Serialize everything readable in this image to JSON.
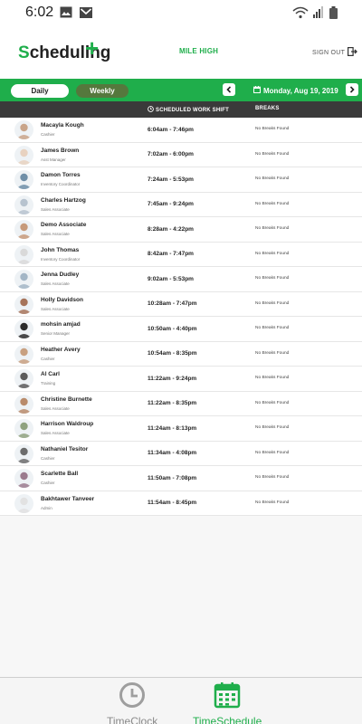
{
  "status_bar": {
    "time": "6:02"
  },
  "header": {
    "logo_letter": "S",
    "logo_rest": "cheduling",
    "location": "MILE HIGH",
    "sign_out": "SIGN OUT"
  },
  "toolbar": {
    "tab_daily": "Daily",
    "tab_weekly": "Weekly",
    "date": "Monday, Aug 19, 2019"
  },
  "columns": {
    "shift": "SCHEDULED WORK SHIFT",
    "breaks": "BREAKS"
  },
  "rows": [
    {
      "name": "Macayla Kough",
      "role": "Cashier",
      "shift": "6:04am - 7:46pm",
      "breaks": "No Breaks Found"
    },
    {
      "name": "James Brown",
      "role": "Asst Manager",
      "shift": "7:02am - 6:00pm",
      "breaks": "No Breaks Found"
    },
    {
      "name": "Damon  Torres",
      "role": "Inventory Coordinator",
      "shift": "7:24am - 5:53pm",
      "breaks": "No Breaks Found"
    },
    {
      "name": "Charles Hartzog",
      "role": "Sales Associate",
      "shift": "7:45am - 9:24pm",
      "breaks": "No Breaks Found"
    },
    {
      "name": "Demo Associate",
      "role": "Sales Associate",
      "shift": "8:28am - 4:22pm",
      "breaks": "No Breaks Found"
    },
    {
      "name": "John Thomas",
      "role": "Inventory Coordinator",
      "shift": "8:42am - 7:47pm",
      "breaks": "No Breaks Found"
    },
    {
      "name": "Jenna Dudley",
      "role": "Sales Associate",
      "shift": "9:02am - 5:53pm",
      "breaks": "No Breaks Found"
    },
    {
      "name": "Holly Davidson",
      "role": "Sales Associate",
      "shift": "10:28am - 7:47pm",
      "breaks": "No Breaks Found"
    },
    {
      "name": "mohsin amjad",
      "role": "Senior Manager",
      "shift": "10:50am - 4:40pm",
      "breaks": "No Breaks Found"
    },
    {
      "name": "Heather Avery",
      "role": "Cashier",
      "shift": "10:54am - 8:35pm",
      "breaks": "No Breaks Found"
    },
    {
      "name": "Al Carl",
      "role": "Training",
      "shift": "11:22am - 9:24pm",
      "breaks": "No Breaks Found"
    },
    {
      "name": "Christine Burnette",
      "role": "Sales Associate",
      "shift": "11:22am - 8:35pm",
      "breaks": "No Breaks Found"
    },
    {
      "name": "Harrison Waldroup",
      "role": "Sales Associate",
      "shift": "11:24am - 8:13pm",
      "breaks": "No Breaks Found"
    },
    {
      "name": "Nathaniel Tesitor",
      "role": "Cashier",
      "shift": "11:34am - 4:08pm",
      "breaks": "No Breaks Found"
    },
    {
      "name": "Scarlette Ball",
      "role": "Cashier",
      "shift": "11:50am - 7:08pm",
      "breaks": "No Breaks Found"
    },
    {
      "name": "Bakhtawer Tanveer",
      "role": "Admin",
      "shift": "11:54am - 8:45pm",
      "breaks": "No Breaks Found"
    }
  ],
  "bottom_nav": {
    "timeclock": "TimeClock",
    "timeschedule": "TimeSchedule"
  },
  "colors": {
    "brand_green": "#1fae4b",
    "weekly_tab": "#55783d",
    "column_header": "#3a3a3a"
  },
  "icons": [
    "image-icon",
    "gmail-icon",
    "wifi-icon",
    "signal-icon",
    "battery-icon",
    "sign-out-icon",
    "chevron-left-icon",
    "calendar-icon",
    "chevron-right-icon",
    "clock-icon",
    "timeclock-icon",
    "timeschedule-calendar-icon"
  ]
}
